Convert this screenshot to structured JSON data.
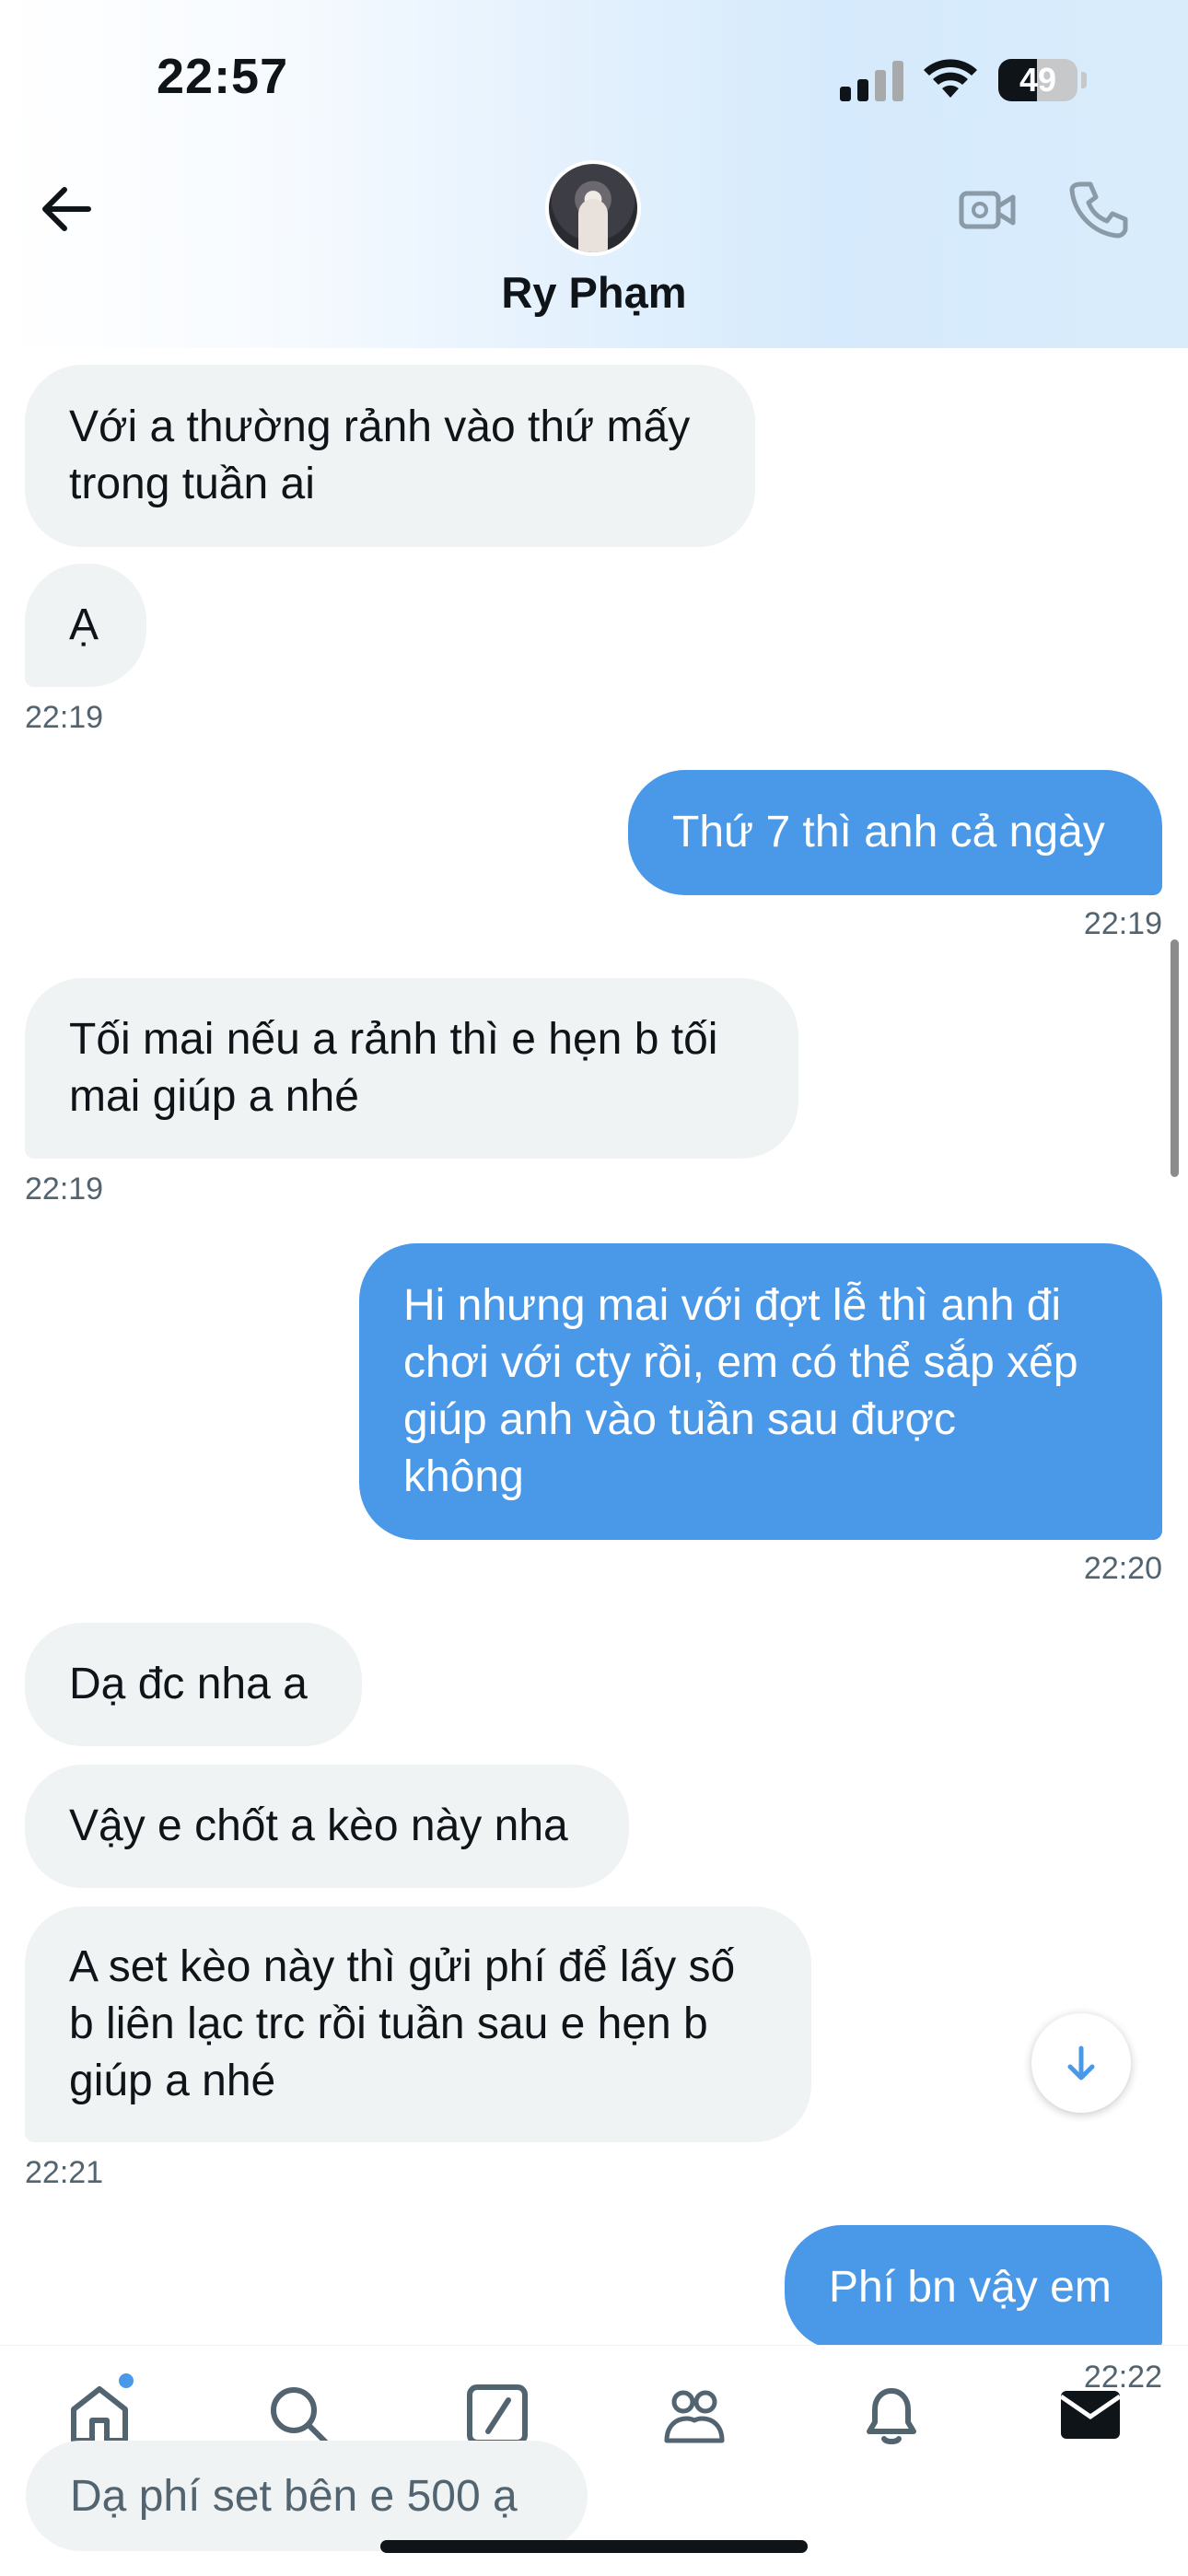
{
  "status_bar": {
    "time": "22:57",
    "battery": "49",
    "battery_level": 0.49
  },
  "header": {
    "contact_name": "Ry Phạm",
    "icons": {
      "back": "back-arrow-icon",
      "video": "video-call-icon",
      "phone": "phone-call-icon"
    }
  },
  "messages": [
    {
      "direction": "incoming",
      "text": "Với a thường rảnh vào thứ mấy\ntrong tuần ai",
      "time": ""
    },
    {
      "direction": "incoming",
      "text": "Ạ",
      "time": "22:19"
    },
    {
      "direction": "outgoing",
      "text": "Thứ 7 thì anh cả ngày",
      "time": "22:19"
    },
    {
      "direction": "incoming",
      "text": "Tối mai nếu a rảnh thì e hẹn b tối\nmai giúp a nhé",
      "time": "22:19"
    },
    {
      "direction": "outgoing",
      "text": "Hi nhưng mai với đợt lễ thì anh đi\nchơi với cty rồi, em có thể sắp xếp\ngiúp anh vào tuần sau được\nkhông",
      "time": "22:20"
    },
    {
      "direction": "incoming",
      "text": "Dạ đc nha a",
      "time": ""
    },
    {
      "direction": "incoming",
      "text": "Vậy e chốt a kèo này nha",
      "time": ""
    },
    {
      "direction": "incoming",
      "text": "A set kèo này thì gửi phí để lấy số\nb liên lạc trc rồi tuần sau e hẹn b\ngiúp a nhé",
      "time": "22:21"
    },
    {
      "direction": "outgoing",
      "text": "Phí bn vậy em",
      "time": "22:22"
    }
  ],
  "composer": {
    "text": "Dạ phí set bên e 500 ạ"
  },
  "tab_bar": {
    "tabs": [
      {
        "name": "home",
        "icon": "home-icon"
      },
      {
        "name": "search",
        "icon": "search-icon"
      },
      {
        "name": "compose",
        "icon": "compose-icon"
      },
      {
        "name": "communities",
        "icon": "communities-icon"
      },
      {
        "name": "notifications",
        "icon": "bell-icon"
      },
      {
        "name": "messages",
        "icon": "mail-icon"
      }
    ]
  },
  "colors": {
    "outgoing_bubble": "#4a99e9",
    "incoming_bubble": "#eff3f4",
    "timestamp": "#536471",
    "text": "#0f1419"
  }
}
